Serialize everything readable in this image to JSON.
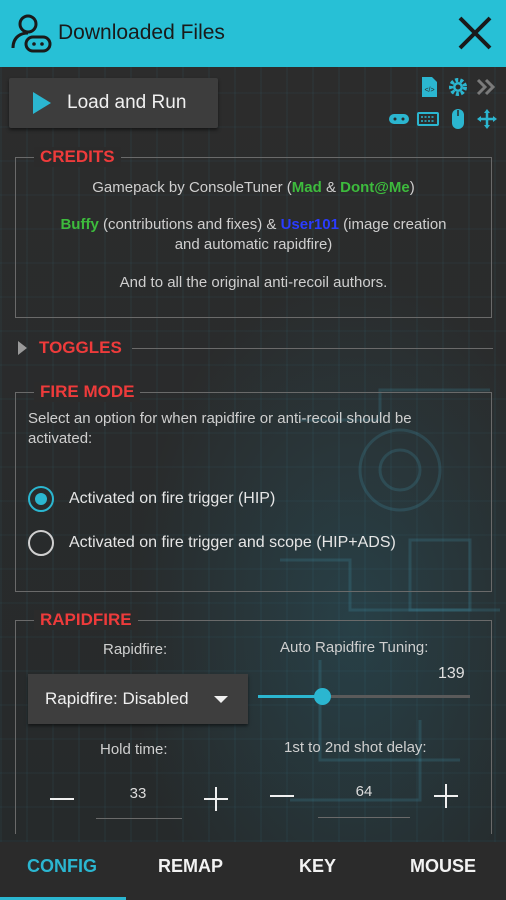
{
  "window": {
    "title": "Downloaded Files"
  },
  "toolbar": {
    "load_run_label": "Load and Run"
  },
  "credits": {
    "title": "CREDITS",
    "line1_prefix": "Gamepack by ConsoleTuner (",
    "line1_name1": "Mad",
    "line1_amp": " & ",
    "line1_name2": "Dont@Me",
    "line1_suffix": ")",
    "line2_name1": "Buffy",
    "line2_mid": " (contributions and fixes) & ",
    "line2_name2": "User101",
    "line2_suffix": " (image creation",
    "line3": "and automatic rapidfire)",
    "line4": "And to all the original anti-recoil authors."
  },
  "toggles": {
    "title": "TOGGLES"
  },
  "fire_mode": {
    "title": "FIRE MODE",
    "description": "Select an option for when rapidfire or anti-recoil should be activated:",
    "options": [
      {
        "label": "Activated on fire trigger (HIP)",
        "selected": true
      },
      {
        "label": "Activated on fire trigger and scope (HIP+ADS)",
        "selected": false
      }
    ]
  },
  "rapidfire": {
    "title": "RAPIDFIRE",
    "rapidfire_label": "Rapidfire:",
    "rapidfire_value": "Rapidfire: Disabled",
    "auto_tuning_label": "Auto Rapidfire Tuning:",
    "auto_tuning_value": "139",
    "auto_tuning_fraction": 0.3,
    "hold_time_label": "Hold time:",
    "hold_time_value": "33",
    "shot_delay_label": "1st to 2nd shot delay:",
    "shot_delay_value": "64"
  },
  "tabs": [
    {
      "label": "CONFIG",
      "active": true
    },
    {
      "label": "REMAP",
      "active": false
    },
    {
      "label": "KEY",
      "active": false
    },
    {
      "label": "MOUSE",
      "active": false
    }
  ],
  "colors": {
    "accent": "#2bb6d0",
    "section_title": "#ee3b3b",
    "credit_green": "#3dbb3d",
    "credit_blue": "#2a3cff"
  },
  "icons": [
    "user-gamepad-icon",
    "close-icon",
    "play-icon",
    "script-file-icon",
    "gear-icon",
    "double-chevron-icon",
    "gamepad-icon",
    "keyboard-icon",
    "mouse-icon",
    "move-arrows-icon"
  ]
}
